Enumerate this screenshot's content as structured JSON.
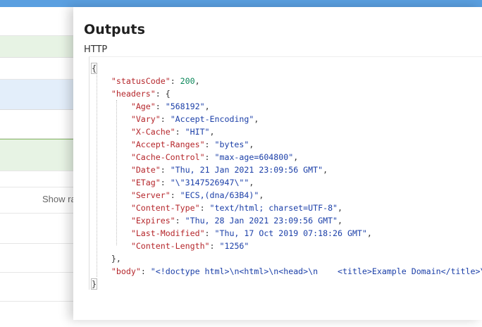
{
  "panel": {
    "title": "Outputs",
    "section_label": "HTTP"
  },
  "background": {
    "show_raw_label": "Show raw inputs"
  },
  "output": {
    "open_brace": "{",
    "close_brace": "}",
    "status_key": "\"statusCode\"",
    "status_value": "200",
    "headers_key": "\"headers\"",
    "headers_open": "{",
    "headers_close": "},",
    "headers": [
      {
        "key": "\"Age\"",
        "value": "\"568192\""
      },
      {
        "key": "\"Vary\"",
        "value": "\"Accept-Encoding\""
      },
      {
        "key": "\"X-Cache\"",
        "value": "\"HIT\""
      },
      {
        "key": "\"Accept-Ranges\"",
        "value": "\"bytes\""
      },
      {
        "key": "\"Cache-Control\"",
        "value": "\"max-age=604800\""
      },
      {
        "key": "\"Date\"",
        "value": "\"Thu, 21 Jan 2021 23:09:56 GMT\""
      },
      {
        "key": "\"ETag\"",
        "value": "\"\\\"3147526947\\\"\""
      },
      {
        "key": "\"Server\"",
        "value": "\"ECS,(dna/63B4)\""
      },
      {
        "key": "\"Content-Type\"",
        "value": "\"text/html; charset=UTF-8\""
      },
      {
        "key": "\"Expires\"",
        "value": "\"Thu, 28 Jan 2021 23:09:56 GMT\""
      },
      {
        "key": "\"Last-Modified\"",
        "value": "\"Thu, 17 Oct 2019 07:18:26 GMT\""
      },
      {
        "key": "\"Content-Length\"",
        "value": "\"1256\""
      }
    ],
    "body_key": "\"body\"",
    "body_value": "\"<!doctype html>\\n<html>\\n<head>\\n    <title>Example Domain</title>\\n"
  },
  "colors": {
    "topbar": "#5a9fe0",
    "json_key": "#b5262b",
    "json_string": "#1b3fa8",
    "json_number": "#098658"
  }
}
